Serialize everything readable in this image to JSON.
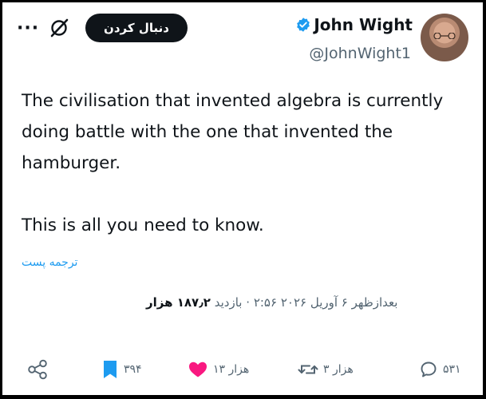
{
  "author": {
    "display_name": "John Wight",
    "handle": "@JohnWight1",
    "verified": true
  },
  "header": {
    "follow_label": "دنبال کردن",
    "more_icon": "more-icon",
    "grok_icon": "grok-icon"
  },
  "tweet": {
    "text": "The civilisation that invented algebra is currently\ndoing battle with the one that invented the\nhamburger.\n\nThis is all you need to know.",
    "translate_label": "ترجمه پست"
  },
  "meta": {
    "timestamp": "بعدازظهر ۶ آوریل ۲۰۲۶ ۲:۵۶",
    "views_label": "بازدید",
    "views_count": "۱۸۷٫۲ هزار",
    "separator": "·"
  },
  "actions": {
    "replies": "۵۳۱",
    "reposts": "۳ هزار",
    "likes": "۱۳ هزار",
    "bookmarks": "۳۹۴"
  },
  "colors": {
    "accent": "#1d9bf0",
    "like": "#f91880",
    "text": "#0f1419",
    "muted": "#536471"
  }
}
